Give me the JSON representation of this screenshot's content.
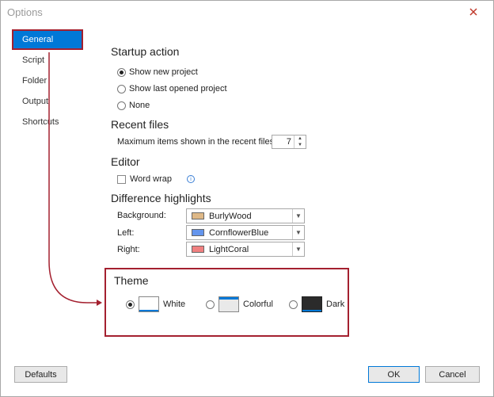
{
  "window": {
    "title": "Options"
  },
  "nav": {
    "items": [
      "General",
      "Script",
      "Folder",
      "Output",
      "Shortcuts"
    ]
  },
  "startup": {
    "title": "Startup action",
    "options": [
      "Show new project",
      "Show last opened project",
      "None"
    ],
    "selected": "Show new project"
  },
  "recent": {
    "title": "Recent files",
    "label": "Maximum items shown in the recent files list:",
    "value": "7"
  },
  "editor": {
    "title": "Editor",
    "word_wrap_label": "Word wrap",
    "word_wrap_checked": false
  },
  "highlights": {
    "title": "Difference highlights",
    "rows": [
      {
        "label": "Background:",
        "value": "BurlyWood",
        "color": "#deb887"
      },
      {
        "label": "Left:",
        "value": "CornflowerBlue",
        "color": "#6495ed"
      },
      {
        "label": "Right:",
        "value": "LightCoral",
        "color": "#f08080"
      }
    ]
  },
  "theme": {
    "title": "Theme",
    "options": [
      "White",
      "Colorful",
      "Dark"
    ],
    "selected": "White"
  },
  "buttons": {
    "defaults": "Defaults",
    "ok": "OK",
    "cancel": "Cancel"
  },
  "colors": {
    "accent": "#0078d7",
    "callout": "#a4202f"
  }
}
